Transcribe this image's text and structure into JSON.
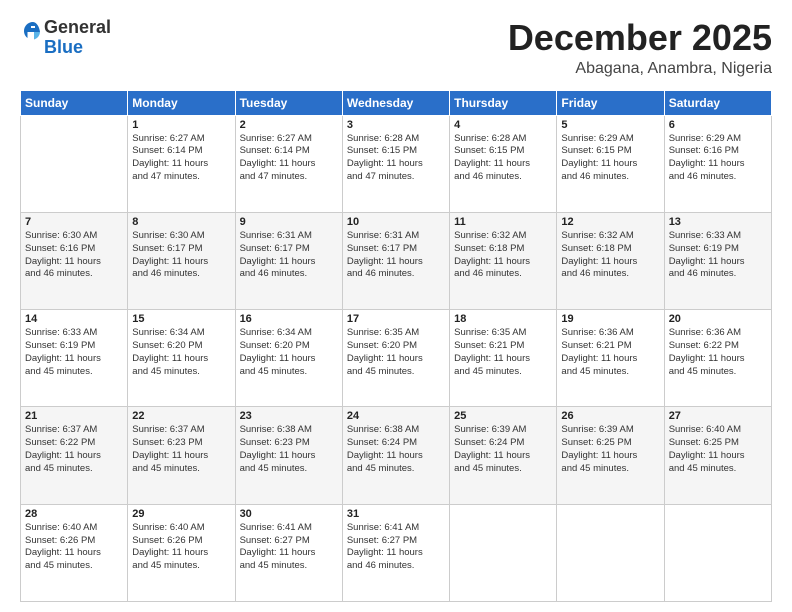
{
  "logo": {
    "general": "General",
    "blue": "Blue"
  },
  "header": {
    "month": "December 2025",
    "location": "Abagana, Anambra, Nigeria"
  },
  "days_of_week": [
    "Sunday",
    "Monday",
    "Tuesday",
    "Wednesday",
    "Thursday",
    "Friday",
    "Saturday"
  ],
  "weeks": [
    [
      {
        "day": "",
        "info": ""
      },
      {
        "day": "1",
        "info": "Sunrise: 6:27 AM\nSunset: 6:14 PM\nDaylight: 11 hours\nand 47 minutes."
      },
      {
        "day": "2",
        "info": "Sunrise: 6:27 AM\nSunset: 6:14 PM\nDaylight: 11 hours\nand 47 minutes."
      },
      {
        "day": "3",
        "info": "Sunrise: 6:28 AM\nSunset: 6:15 PM\nDaylight: 11 hours\nand 47 minutes."
      },
      {
        "day": "4",
        "info": "Sunrise: 6:28 AM\nSunset: 6:15 PM\nDaylight: 11 hours\nand 46 minutes."
      },
      {
        "day": "5",
        "info": "Sunrise: 6:29 AM\nSunset: 6:15 PM\nDaylight: 11 hours\nand 46 minutes."
      },
      {
        "day": "6",
        "info": "Sunrise: 6:29 AM\nSunset: 6:16 PM\nDaylight: 11 hours\nand 46 minutes."
      }
    ],
    [
      {
        "day": "7",
        "info": "Sunrise: 6:30 AM\nSunset: 6:16 PM\nDaylight: 11 hours\nand 46 minutes."
      },
      {
        "day": "8",
        "info": "Sunrise: 6:30 AM\nSunset: 6:17 PM\nDaylight: 11 hours\nand 46 minutes."
      },
      {
        "day": "9",
        "info": "Sunrise: 6:31 AM\nSunset: 6:17 PM\nDaylight: 11 hours\nand 46 minutes."
      },
      {
        "day": "10",
        "info": "Sunrise: 6:31 AM\nSunset: 6:17 PM\nDaylight: 11 hours\nand 46 minutes."
      },
      {
        "day": "11",
        "info": "Sunrise: 6:32 AM\nSunset: 6:18 PM\nDaylight: 11 hours\nand 46 minutes."
      },
      {
        "day": "12",
        "info": "Sunrise: 6:32 AM\nSunset: 6:18 PM\nDaylight: 11 hours\nand 46 minutes."
      },
      {
        "day": "13",
        "info": "Sunrise: 6:33 AM\nSunset: 6:19 PM\nDaylight: 11 hours\nand 46 minutes."
      }
    ],
    [
      {
        "day": "14",
        "info": "Sunrise: 6:33 AM\nSunset: 6:19 PM\nDaylight: 11 hours\nand 45 minutes."
      },
      {
        "day": "15",
        "info": "Sunrise: 6:34 AM\nSunset: 6:20 PM\nDaylight: 11 hours\nand 45 minutes."
      },
      {
        "day": "16",
        "info": "Sunrise: 6:34 AM\nSunset: 6:20 PM\nDaylight: 11 hours\nand 45 minutes."
      },
      {
        "day": "17",
        "info": "Sunrise: 6:35 AM\nSunset: 6:20 PM\nDaylight: 11 hours\nand 45 minutes."
      },
      {
        "day": "18",
        "info": "Sunrise: 6:35 AM\nSunset: 6:21 PM\nDaylight: 11 hours\nand 45 minutes."
      },
      {
        "day": "19",
        "info": "Sunrise: 6:36 AM\nSunset: 6:21 PM\nDaylight: 11 hours\nand 45 minutes."
      },
      {
        "day": "20",
        "info": "Sunrise: 6:36 AM\nSunset: 6:22 PM\nDaylight: 11 hours\nand 45 minutes."
      }
    ],
    [
      {
        "day": "21",
        "info": "Sunrise: 6:37 AM\nSunset: 6:22 PM\nDaylight: 11 hours\nand 45 minutes."
      },
      {
        "day": "22",
        "info": "Sunrise: 6:37 AM\nSunset: 6:23 PM\nDaylight: 11 hours\nand 45 minutes."
      },
      {
        "day": "23",
        "info": "Sunrise: 6:38 AM\nSunset: 6:23 PM\nDaylight: 11 hours\nand 45 minutes."
      },
      {
        "day": "24",
        "info": "Sunrise: 6:38 AM\nSunset: 6:24 PM\nDaylight: 11 hours\nand 45 minutes."
      },
      {
        "day": "25",
        "info": "Sunrise: 6:39 AM\nSunset: 6:24 PM\nDaylight: 11 hours\nand 45 minutes."
      },
      {
        "day": "26",
        "info": "Sunrise: 6:39 AM\nSunset: 6:25 PM\nDaylight: 11 hours\nand 45 minutes."
      },
      {
        "day": "27",
        "info": "Sunrise: 6:40 AM\nSunset: 6:25 PM\nDaylight: 11 hours\nand 45 minutes."
      }
    ],
    [
      {
        "day": "28",
        "info": "Sunrise: 6:40 AM\nSunset: 6:26 PM\nDaylight: 11 hours\nand 45 minutes."
      },
      {
        "day": "29",
        "info": "Sunrise: 6:40 AM\nSunset: 6:26 PM\nDaylight: 11 hours\nand 45 minutes."
      },
      {
        "day": "30",
        "info": "Sunrise: 6:41 AM\nSunset: 6:27 PM\nDaylight: 11 hours\nand 45 minutes."
      },
      {
        "day": "31",
        "info": "Sunrise: 6:41 AM\nSunset: 6:27 PM\nDaylight: 11 hours\nand 46 minutes."
      },
      {
        "day": "",
        "info": ""
      },
      {
        "day": "",
        "info": ""
      },
      {
        "day": "",
        "info": ""
      }
    ]
  ]
}
